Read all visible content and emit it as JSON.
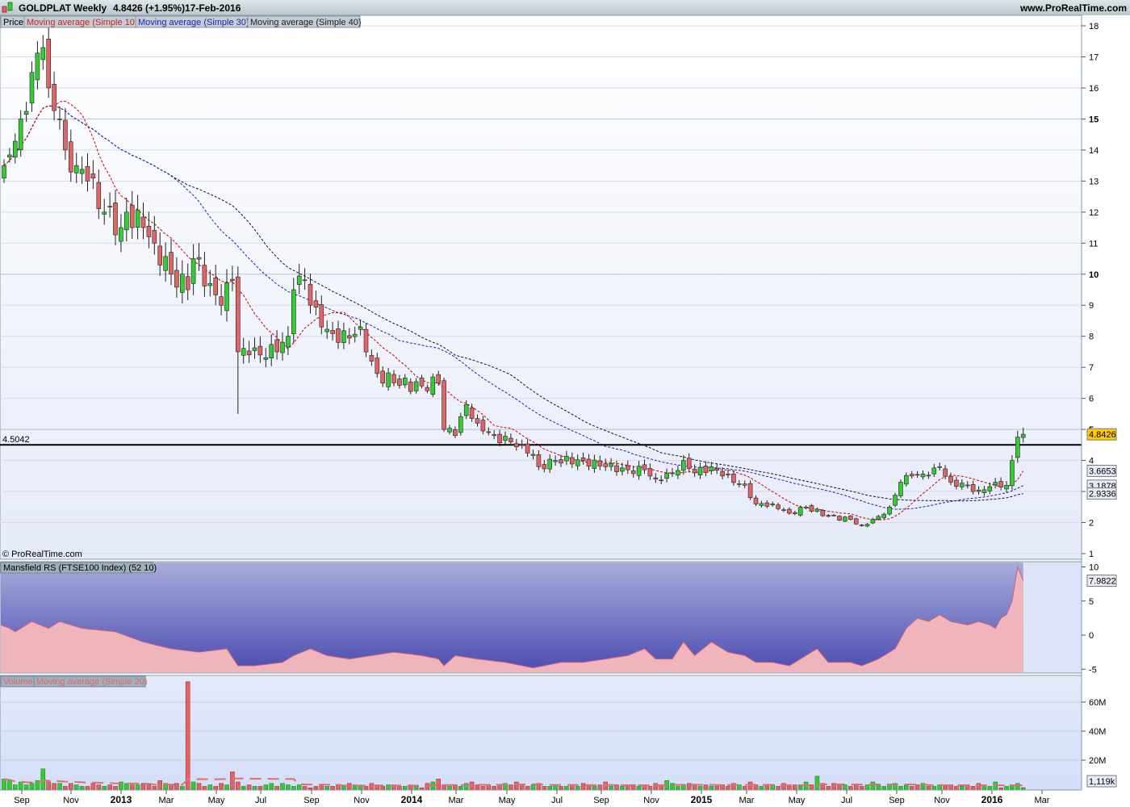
{
  "header": {
    "symbol": "GOLDPLAT",
    "period": "Weekly",
    "last_change": "4.8426 (+1.95%)",
    "date": "17-Feb-2016",
    "site": "www.ProRealTime.com",
    "copyright": "© ProRealTime.com"
  },
  "legend": {
    "price": "Price",
    "ma10": "Moving average (Simple 10)",
    "ma30": "Moving average (Simple 30)",
    "ma40": "Moving average (Simple 40)",
    "rs": "Mansfield RS (FTSE100 Index) (52 10)",
    "volume": "Volume",
    "vol_ma": "Moving average (Simple 20)"
  },
  "colors": {
    "up": "#33cc33",
    "down": "#e06666",
    "ma10": "#cc0000",
    "ma30": "#2222aa",
    "ma40": "#111133",
    "last_price_bg": "#ffcc00"
  },
  "chart_data": [
    {
      "type": "candlestick",
      "title": "GOLDPLAT Weekly",
      "ylim": [
        1,
        18
      ],
      "y_ticks": [
        "18",
        "17",
        "16",
        "15",
        "14",
        "13",
        "12",
        "11",
        "10",
        "9",
        "8",
        "7",
        "6",
        "5",
        "4",
        "3",
        "2",
        "1"
      ],
      "x_ticks": [
        "Sep",
        "Nov",
        "2013",
        "Mar",
        "May",
        "Jul",
        "Sep",
        "Nov",
        "2014",
        "Mar",
        "May",
        "Jul",
        "Sep",
        "Nov",
        "2015",
        "Mar",
        "May",
        "Jul",
        "Sep",
        "Nov",
        "2016",
        "Mar"
      ],
      "weeks": 184,
      "close_keypoints": [
        [
          0,
          13.5
        ],
        [
          3,
          15
        ],
        [
          5,
          16.5
        ],
        [
          7,
          17.3
        ],
        [
          8,
          16
        ],
        [
          10,
          15
        ],
        [
          11,
          14
        ],
        [
          13,
          13.5
        ],
        [
          15,
          13
        ],
        [
          18,
          12
        ],
        [
          21,
          11.5
        ],
        [
          22,
          12
        ],
        [
          25,
          11.5
        ],
        [
          27,
          11
        ],
        [
          30,
          10
        ],
        [
          33,
          9.5
        ],
        [
          34,
          10.5
        ],
        [
          37,
          9.7
        ],
        [
          39,
          9
        ],
        [
          41,
          9.8
        ],
        [
          42,
          7.5
        ],
        [
          44,
          7.4
        ],
        [
          49,
          7.5
        ],
        [
          51,
          8
        ],
        [
          52,
          9.5
        ],
        [
          54,
          9.8
        ],
        [
          55,
          9
        ],
        [
          57,
          8.3
        ],
        [
          60,
          7.8
        ],
        [
          64,
          8.3
        ],
        [
          66,
          7.2
        ],
        [
          67,
          6.8
        ],
        [
          70,
          6.5
        ],
        [
          75,
          6.4
        ],
        [
          78,
          6.5
        ],
        [
          79,
          5
        ],
        [
          81,
          4.8
        ],
        [
          83,
          5.8
        ],
        [
          85,
          5.2
        ],
        [
          88,
          4.8
        ],
        [
          91,
          4.6
        ],
        [
          93,
          4.5
        ],
        [
          95,
          4.2
        ],
        [
          96,
          3.8
        ],
        [
          99,
          4.0
        ],
        [
          104,
          4.0
        ],
        [
          108,
          3.8
        ],
        [
          112,
          3.7
        ],
        [
          115,
          3.7
        ],
        [
          117,
          3.4
        ],
        [
          120,
          3.6
        ],
        [
          122,
          4.0
        ],
        [
          124,
          3.6
        ],
        [
          127,
          3.8
        ],
        [
          129,
          3.5
        ],
        [
          133,
          3.2
        ],
        [
          135,
          2.6
        ],
        [
          138,
          2.6
        ],
        [
          141,
          2.3
        ],
        [
          144,
          2.5
        ],
        [
          148,
          2.2
        ],
        [
          152,
          2.1
        ],
        [
          154,
          1.9
        ],
        [
          157,
          2.2
        ],
        [
          159,
          2.5
        ],
        [
          161,
          3.3
        ],
        [
          163,
          3.5
        ],
        [
          166,
          3.5
        ],
        [
          168,
          3.8
        ],
        [
          170,
          3.3
        ],
        [
          173,
          3.2
        ],
        [
          175,
          3.0
        ],
        [
          178,
          3.3
        ],
        [
          180,
          3.2
        ],
        [
          181,
          4.0
        ],
        [
          182,
          4.75
        ],
        [
          183,
          4.8426
        ]
      ],
      "low_overrides": [
        [
          42,
          5.5
        ]
      ],
      "horizontal_line": {
        "value": 4.5042,
        "label": "4.5042"
      },
      "last_values": {
        "price": "4.8426",
        "ma10": "3.6653",
        "ma30": "3.1878",
        "ma40": "2.9336"
      }
    },
    {
      "type": "area",
      "title": "Mansfield RS (FTSE100 Index) (52 10)",
      "ylim": [
        -6,
        11
      ],
      "y_ticks": [
        "10",
        "5",
        "0",
        "-5"
      ],
      "keypoints": [
        [
          0,
          1.5
        ],
        [
          2,
          0.5
        ],
        [
          5,
          2
        ],
        [
          8,
          1
        ],
        [
          10,
          2
        ],
        [
          14,
          1
        ],
        [
          20,
          0.5
        ],
        [
          25,
          -1
        ],
        [
          30,
          -2
        ],
        [
          35,
          -2.5
        ],
        [
          40,
          -2
        ],
        [
          42,
          -4.5
        ],
        [
          45,
          -4.5
        ],
        [
          50,
          -4
        ],
        [
          52,
          -3
        ],
        [
          55,
          -2
        ],
        [
          58,
          -3
        ],
        [
          62,
          -3.5
        ],
        [
          66,
          -3
        ],
        [
          70,
          -2.5
        ],
        [
          75,
          -3
        ],
        [
          78,
          -3.5
        ],
        [
          79,
          -4.5
        ],
        [
          81,
          -3
        ],
        [
          85,
          -3.5
        ],
        [
          90,
          -4
        ],
        [
          95,
          -4.8
        ],
        [
          100,
          -4
        ],
        [
          104,
          -4
        ],
        [
          108,
          -3.5
        ],
        [
          112,
          -3
        ],
        [
          115,
          -2
        ],
        [
          117,
          -3.5
        ],
        [
          120,
          -3.5
        ],
        [
          122,
          -1
        ],
        [
          124,
          -3
        ],
        [
          127,
          -1
        ],
        [
          130,
          -2.5
        ],
        [
          133,
          -3
        ],
        [
          135,
          -4
        ],
        [
          138,
          -4
        ],
        [
          141,
          -4.5
        ],
        [
          144,
          -3
        ],
        [
          146,
          -2
        ],
        [
          148,
          -4
        ],
        [
          152,
          -4
        ],
        [
          154,
          -4.5
        ],
        [
          157,
          -3.5
        ],
        [
          160,
          -2
        ],
        [
          162,
          1
        ],
        [
          164,
          2.5
        ],
        [
          166,
          2
        ],
        [
          168,
          3
        ],
        [
          170,
          2
        ],
        [
          173,
          1.5
        ],
        [
          175,
          2
        ],
        [
          177,
          1.5
        ],
        [
          178,
          1
        ],
        [
          179,
          2.5
        ],
        [
          180,
          3
        ],
        [
          181,
          5
        ],
        [
          182,
          10
        ],
        [
          183,
          7.9822
        ]
      ],
      "last_value": "7.9822"
    },
    {
      "type": "bar",
      "title": "Volume",
      "unit": "M",
      "ylim": [
        0,
        80
      ],
      "y_ticks": [
        "60M",
        "40M",
        "20M"
      ],
      "values": [
        7,
        6,
        3,
        5,
        3,
        4,
        6,
        14,
        5,
        4,
        4,
        2,
        4,
        3,
        2,
        2,
        4,
        3,
        2,
        3,
        2,
        5,
        4,
        3,
        3,
        4,
        3,
        2,
        6,
        4,
        3,
        4,
        2,
        74,
        5,
        4,
        2,
        3,
        2,
        4,
        3,
        12,
        5,
        2,
        3,
        2,
        2,
        3,
        4,
        2,
        4,
        3,
        2,
        3,
        2,
        1,
        2,
        3,
        2,
        2,
        3,
        2,
        4,
        3,
        2,
        2,
        4,
        3,
        2,
        3,
        3,
        2,
        2,
        3,
        2,
        1,
        4,
        5,
        7,
        3,
        2,
        3,
        2,
        4,
        5,
        3,
        2,
        3,
        2,
        3,
        4,
        3,
        5,
        3,
        2,
        3,
        4,
        2,
        2,
        3,
        2,
        2,
        3,
        2,
        4,
        3,
        2,
        3,
        5,
        2,
        3,
        2,
        3,
        3,
        2,
        3,
        2,
        4,
        3,
        6,
        4,
        2,
        3,
        4,
        3,
        2,
        3,
        2,
        2,
        3,
        2,
        4,
        3,
        2,
        5,
        3,
        2,
        3,
        3,
        2,
        4,
        2,
        3,
        2,
        5,
        3,
        9,
        4,
        2,
        4,
        3,
        3,
        2,
        3,
        2,
        3,
        5,
        3,
        2,
        3,
        4,
        2,
        3,
        2,
        3,
        4,
        2,
        2,
        3,
        2,
        3,
        2,
        2,
        3,
        2,
        4,
        3,
        2,
        5,
        1,
        2,
        3,
        4,
        1.1
      ],
      "last_value": "1,119k"
    }
  ]
}
